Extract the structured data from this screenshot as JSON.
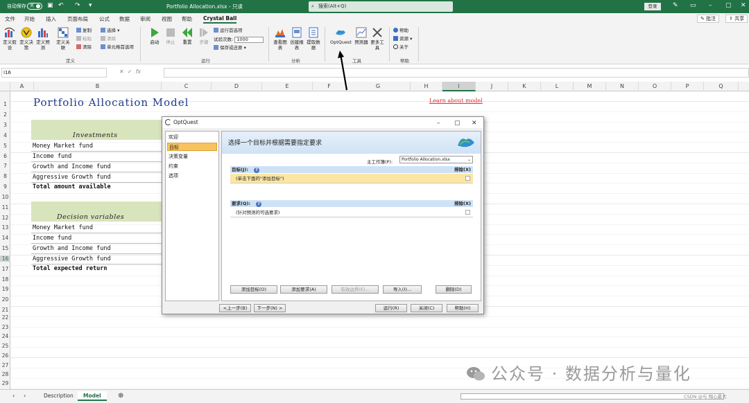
{
  "titlebar": {
    "autosave_label": "自动保存",
    "autosave_state": "关",
    "doc_title": "Portfolio Allocation.xlsx  -  只读",
    "search_placeholder": "搜索(Alt+Q)",
    "login_label": "登录"
  },
  "menu": {
    "tabs": [
      "文件",
      "开始",
      "插入",
      "页面布局",
      "公式",
      "数据",
      "审阅",
      "视图",
      "帮助",
      "Crystal Ball"
    ],
    "active_tab": "Crystal Ball",
    "comment_label": "批注",
    "share_label": "共享"
  },
  "ribbon": {
    "define": {
      "buttons": [
        "定义假设",
        "定义决策",
        "定义预测",
        "定义关联"
      ],
      "small": [
        "复制",
        "粘贴",
        "清除",
        "选择",
        "清除",
        "单元格首选项"
      ],
      "label": "定义"
    },
    "run": {
      "buttons": [
        "启动",
        "停止",
        "重置",
        "步骤"
      ],
      "prefs_label": "运行首选项",
      "trials_label": "试验次数:",
      "trials_value": "1000",
      "save_restore_label": "保存或还原",
      "label": "运行"
    },
    "analyze": {
      "buttons": [
        "查看图表",
        "创建报表",
        "提取数据"
      ],
      "label": "分析"
    },
    "tools": {
      "buttons": [
        "OptQuest",
        "预测器",
        "更多工具"
      ],
      "label": "工具"
    },
    "help": {
      "items": [
        "帮助",
        "资源",
        "关于"
      ],
      "label": "帮助"
    }
  },
  "formula": {
    "namebox": "I16",
    "fx": "fx"
  },
  "grid": {
    "columns": [
      "A",
      "B",
      "C",
      "D",
      "E",
      "F",
      "G",
      "H",
      "I",
      "J",
      "K",
      "L",
      "M",
      "N",
      "O",
      "P",
      "Q"
    ],
    "selected_col": "I",
    "rows": [
      "1",
      "2",
      "3",
      "4",
      "5",
      "6",
      "7",
      "8",
      "9",
      "10",
      "11",
      "12",
      "13",
      "14",
      "15",
      "16",
      "17",
      "18",
      "19",
      "20",
      "21",
      "22",
      "23",
      "24",
      "25",
      "26",
      "27",
      "28",
      "29"
    ],
    "selected_row": "16"
  },
  "sheet": {
    "title": "Portfolio Allocation Model",
    "link": "Learn about model",
    "investments_header": "Investments",
    "investments": [
      "Money Market fund",
      "Income fund",
      "Growth and Income fund",
      "Aggressive Growth fund"
    ],
    "total_available": "Total amount available",
    "decision_header": "Decision variables",
    "decisions": [
      "Money Market fund",
      "Income fund",
      "Growth and Income fund",
      "Aggressive Growth fund"
    ],
    "total_return": "Total expected return"
  },
  "sheet_tabs": [
    "Description",
    "Model"
  ],
  "active_sheet": "Model",
  "dialog": {
    "title": "OptQuest",
    "nav": [
      "欢迎",
      "目标",
      "决策变量",
      "约束",
      "选项"
    ],
    "active_nav": "目标",
    "header": "选择一个目标并根据需要指定要求",
    "workbook_label": "主工作簿(P):",
    "workbook_value": "Portfolio Allocation.xlsx",
    "objectives_header": "目标(J):",
    "delete_header": "排除(X)",
    "objective_row": "(单击下面的\"添加目标\")",
    "requirements_header": "要求(Q):",
    "requirement_row": "(针对预测的可选要求)",
    "buttons": [
      "添加目标(O)",
      "添加要求(A)",
      "有效边界(E)...",
      "导入(I)...",
      "删除(D)"
    ],
    "footer_buttons": [
      "<上一步(B)",
      "下一步(N) >",
      "运行(R)",
      "关闭(C)",
      "帮助(H)"
    ]
  },
  "watermark": {
    "text": "公众号 · 数据分析与量化",
    "csdn": "CSDN @与 翔心最大"
  },
  "colors": {
    "excel_green": "#217346",
    "header_band": "#d8e4bc",
    "title_blue": "#1f3d8a",
    "link_red": "#e03030",
    "nav_active": "#f7c35f"
  }
}
